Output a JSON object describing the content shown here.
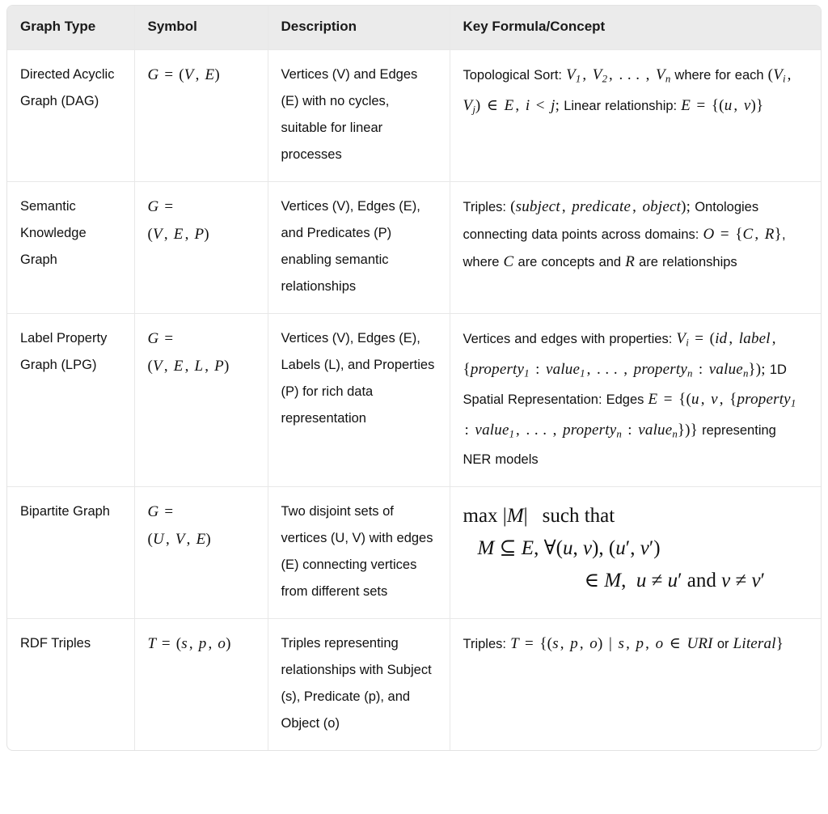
{
  "table": {
    "headers": [
      "Graph Type",
      "Symbol",
      "Description",
      "Key Formula/Concept"
    ],
    "rows": [
      {
        "graph_type": "Directed Acyclic Graph (DAG)",
        "symbol_latex": "G = (V, E)",
        "description": "Vertices (V) and Edges (E) with no cycles, suitable for linear processes",
        "formula_text": "Topological Sort: V₁, V₂, …, Vₙ where for each (Vᵢ, Vⱼ) ∈ E, i < j; Linear relationship: E = {(u, v)}",
        "formula_parts": {
          "label1": "Topological Sort:",
          "math1": "V_1, V_2, \\ldots, V_n",
          "mid1": "where for each",
          "math2": "(V_i, V_j) \\in E, i < j;",
          "mid2": "Linear relationship:",
          "math3": "E = \\{(u,v)\\}"
        }
      },
      {
        "graph_type": "Semantic Knowledge Graph",
        "symbol_latex": "G = (V, E, P)",
        "description": "Vertices (V), Edges (E), and Predicates (P) enabling semantic relationships",
        "formula_text": "Triples: (subject, predicate, object); Ontologies connecting data points across domains: O = {C, R}, where C are concepts and R are relationships",
        "formula_parts": {
          "label1": "Triples:",
          "math1": "(subject, predicate, object);",
          "mid1": "Ontologies connecting data points across domains:",
          "math2": "O = \\{C, R\\}",
          "mid2": ", where",
          "math3": "C",
          "mid3": "are concepts and",
          "math4": "R",
          "mid4": "are relationships"
        }
      },
      {
        "graph_type": "Label Property Graph (LPG)",
        "symbol_latex": "G = (V, E, L, P)",
        "description": "Vertices (V), Edges (E), Labels (L), and Properties (P) for rich data representation",
        "formula_text": "Vertices and edges with properties: Vᵢ = (id, label, {property₁ : value₁, …, propertyₙ : valueₙ}); 1D Spatial Representation: Edges E = {(u, v, {property₁ : value₁, …, propertyₙ : valueₙ})} representing NER models",
        "formula_parts": {
          "label1": "Vertices and edges with properties:",
          "math1": "V_i = (id, label, \\{property_1 : value_1, \\ldots, property_n : value_n\\});",
          "mid1": "1D Spatial Representation: Edges",
          "math2": "E = \\{(u, v, \\{property_1 : value_1, \\ldots, property_n : value_n\\})\\}",
          "mid2": "representing NER models"
        }
      },
      {
        "graph_type": "Bipartite Graph",
        "symbol_latex": "G = (U, V, E)",
        "description": "Two disjoint sets of vertices (U, V) with edges (E) connecting vertices from different sets",
        "formula_text": "max |M| such that M ⊆ E, ∀(u, v), (u′, v′) ∈ M, u ≠ u′ and v ≠ v′",
        "formula_display": true,
        "formula_parts": {
          "line1": "max |M|   such that",
          "line2": "M ⊆ E, ∀(u, v), (u′, v′)",
          "line3": "∈ M,  u ≠ u′ and v ≠ v′"
        }
      },
      {
        "graph_type": "RDF Triples",
        "symbol_latex": "T = (s, p, o)",
        "description": "Triples representing relationships with Subject (s), Predicate (p), and Object (o)",
        "formula_text": "Triples: T = {(s, p, o) | s, p, o ∈ URI or Literal}",
        "formula_parts": {
          "label1": "Triples:",
          "math1": "T = \\{(s,p,o) \\mid s,p,o \\in URI",
          "mid1": "or",
          "math2": "Literal\\}"
        }
      }
    ]
  },
  "style": {
    "header_bg": "#ebebeb",
    "border_color": "#e8e8e8",
    "text_color": "#111111"
  }
}
